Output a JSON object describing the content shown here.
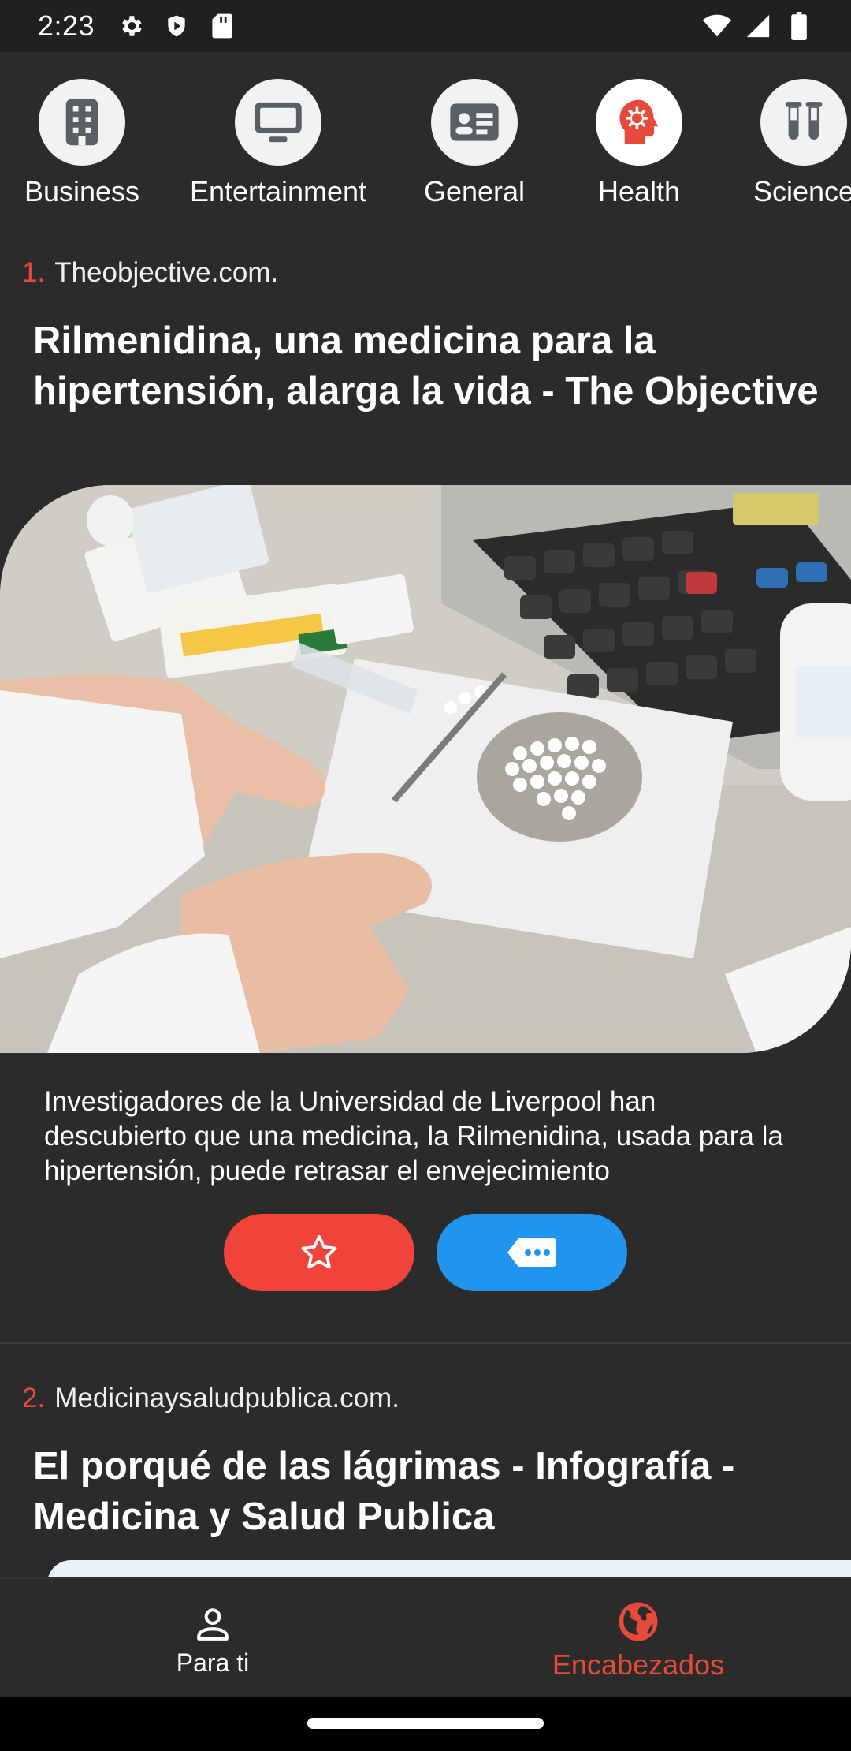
{
  "status_bar": {
    "time": "2:23",
    "icons": [
      "settings-icon",
      "shield-play-icon",
      "sd-card-icon",
      "wifi-icon",
      "signal-icon",
      "battery-icon"
    ]
  },
  "categories": [
    {
      "label": "Business",
      "icon": "building-icon",
      "active": false
    },
    {
      "label": "Entertainment",
      "icon": "monitor-icon",
      "active": false
    },
    {
      "label": "General",
      "icon": "id-card-icon",
      "active": false
    },
    {
      "label": "Health",
      "icon": "virus-head-icon",
      "active": true
    },
    {
      "label": "Science",
      "icon": "test-tubes-icon",
      "active": false
    }
  ],
  "articles": [
    {
      "number": "1.",
      "source": "Theobjective.com.",
      "title": "Rilmenidina, una medicina para la hipertensión, alarga la vida - The Objective",
      "description": "Investigadores de la Universidad de Liverpool han descubierto que una medicina, la Rilmenidina, usada para la hipertensión, puede retrasar el envejecimiento"
    },
    {
      "number": "2.",
      "source": "Medicinaysaludpublica.com.",
      "title": "El porqué de las lágrimas - Infografía - Medicina y Salud Publica"
    }
  ],
  "bottom_nav": [
    {
      "label": "Para ti",
      "icon": "person-icon",
      "active": false
    },
    {
      "label": "Encabezados",
      "icon": "globe-icon",
      "active": true
    }
  ],
  "colors": {
    "accent_red": "#e74a3b",
    "favorite_button": "#f0443a",
    "share_button": "#2094ee",
    "background": "#2b2b2b"
  }
}
